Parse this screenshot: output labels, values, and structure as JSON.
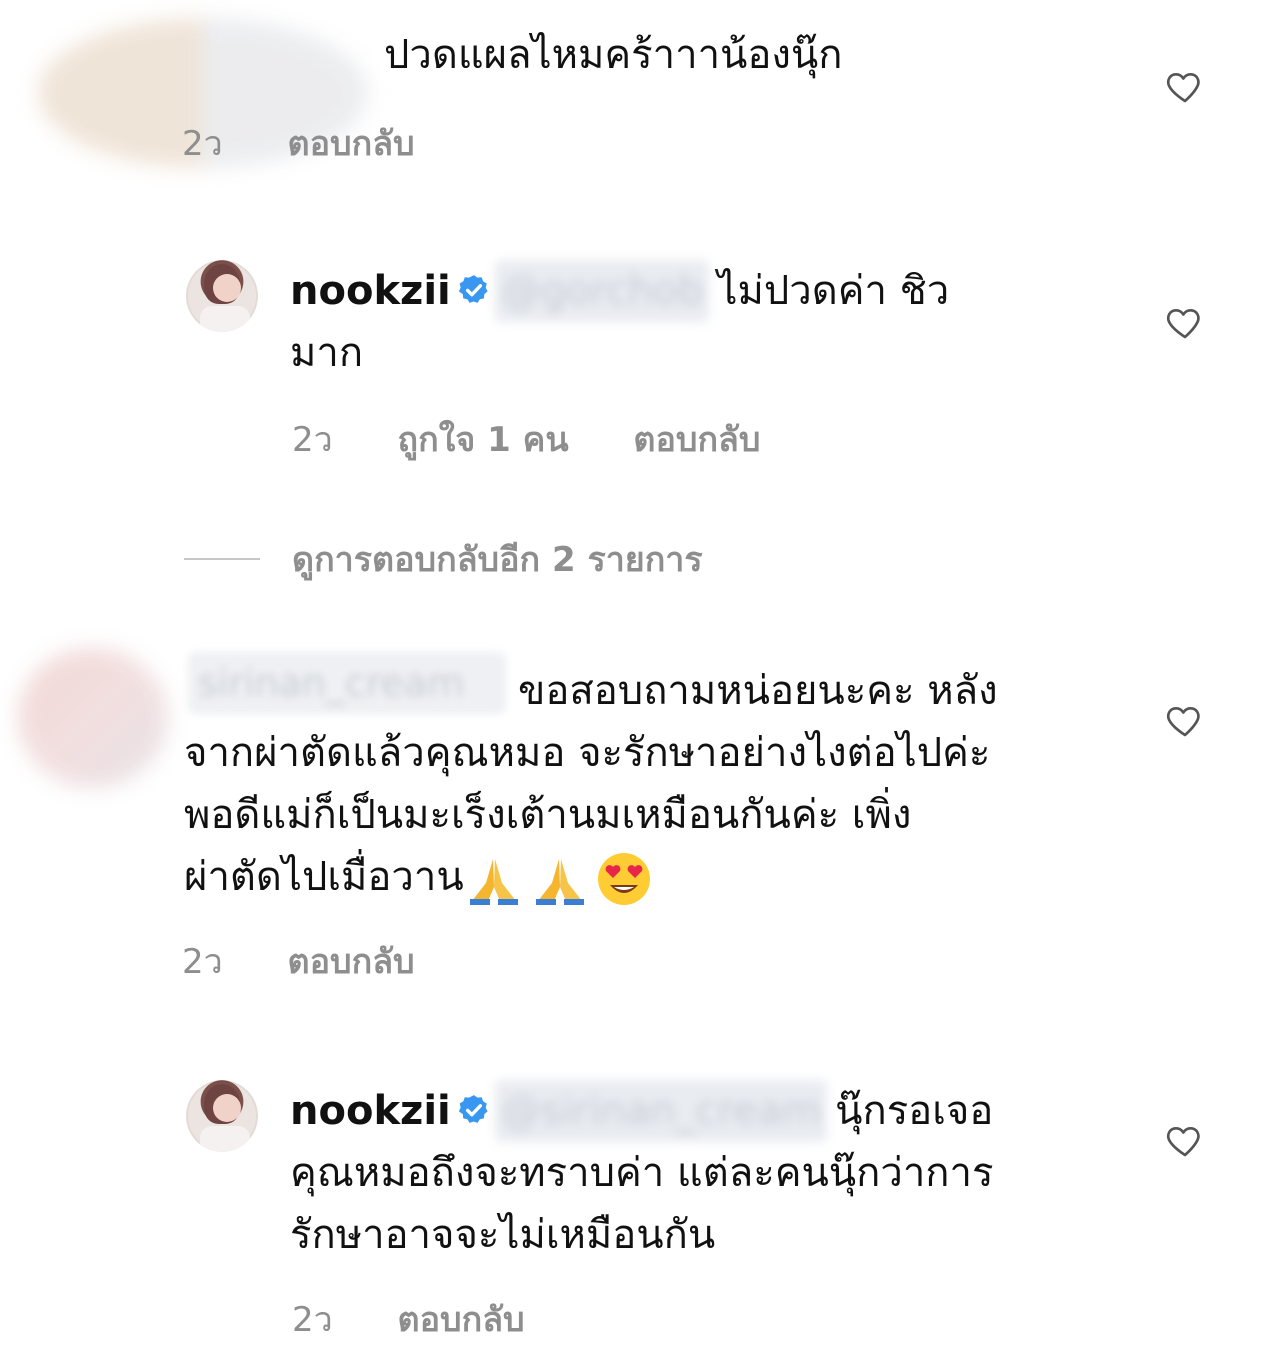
{
  "comments": [
    {
      "text": "ปวดแผลไหมคร้าาาน้องนุ๊ก",
      "time": "2ว",
      "reply_label": "ตอบกลับ",
      "heart_icon": "heart-outline-icon"
    },
    {
      "username": "nookzii",
      "mention": "@gorchob",
      "text_line1": "ไม่ปวดค่า ชิว",
      "text_line2": "มาก",
      "time": "2ว",
      "likes": "ถูกใจ 1 คน",
      "reply_label": "ตอบกลับ",
      "heart_icon": "heart-outline-icon"
    },
    {
      "text_line1": "ขอสอบถามหน่อยนะคะ หลัง",
      "text_line2": "จากผ่าตัดแล้วคุณหมอ จะรักษาอย่างไงต่อไปค่ะ",
      "text_line3": "พอดีแม่ก็เป็นมะเร็งเต้านมเหมือนกันค่ะ เพิ่ง",
      "text_line4": "ผ่าตัดไปเมื่อวาน",
      "username_blurred": "sirinan_cream",
      "time": "2ว",
      "reply_label": "ตอบกลับ",
      "heart_icon": "heart-outline-icon"
    },
    {
      "username": "nookzii",
      "mention": "@sirinan_cream",
      "text_line1": "นุ๊กรอเจอ",
      "text_line2": "คุณหมอถึงจะทราบค่า แต่ละคนนุ๊กว่าการ",
      "text_line3": "รักษาอาจจะไม่เหมือนกัน",
      "time": "2ว",
      "reply_label": "ตอบกลับ",
      "heart_icon": "heart-outline-icon"
    }
  ],
  "view_more_replies": "ดูการตอบกลับอีก 2 รายการ",
  "colors": {
    "text": "#111111",
    "meta": "#8e8e8e",
    "verified": "#3897f0"
  }
}
